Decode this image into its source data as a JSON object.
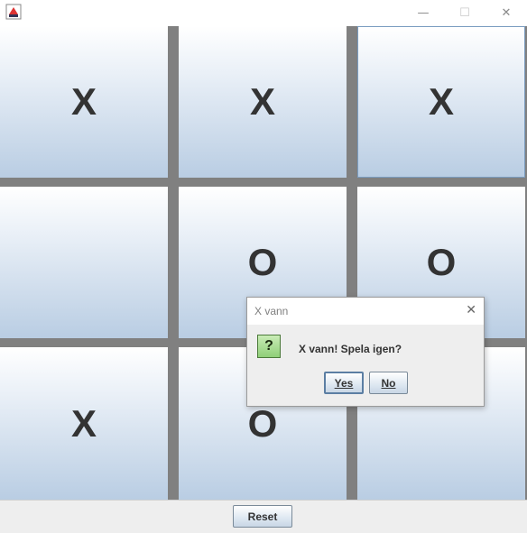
{
  "window": {
    "title": "",
    "min_glyph": "—",
    "max_glyph": "☐",
    "close_glyph": "✕"
  },
  "board": {
    "cells": [
      [
        "X",
        "X",
        "X"
      ],
      [
        "",
        "O",
        "O"
      ],
      [
        "X",
        "O",
        ""
      ]
    ]
  },
  "bottom": {
    "reset_label": "Reset"
  },
  "dialog": {
    "title": "X vann",
    "close_glyph": "✕",
    "icon_glyph": "?",
    "message": "X vann! Spela igen?",
    "yes_label": "Yes",
    "no_label": "No"
  },
  "colors": {
    "divider": "#808080",
    "cell_top": "#ffffff",
    "cell_bottom": "#b9cde3",
    "mark": "#333333",
    "question_icon": "#8fcf78"
  },
  "icons": [
    "app-icon",
    "minimize-icon",
    "maximize-icon",
    "close-icon",
    "question-icon"
  ]
}
